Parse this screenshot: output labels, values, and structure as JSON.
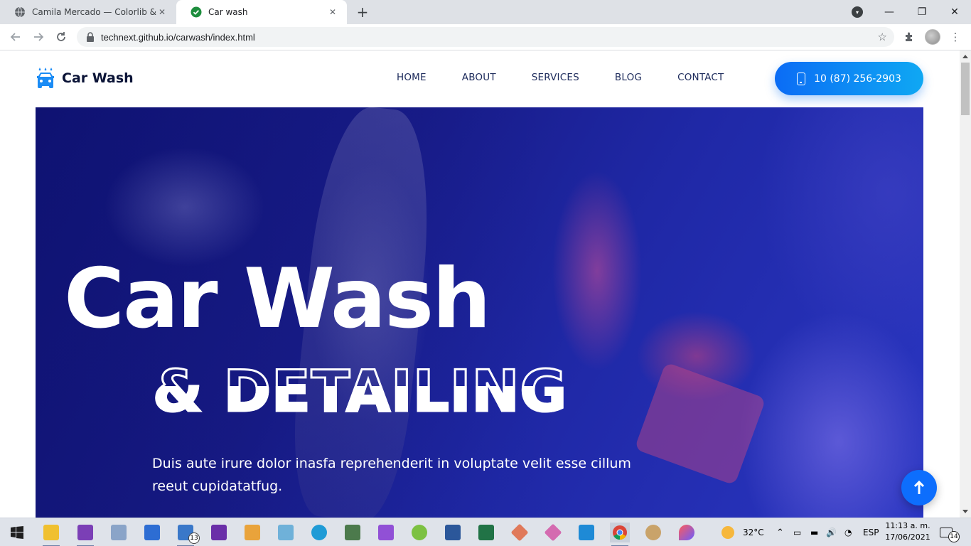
{
  "browser": {
    "tabs": [
      {
        "title": "Camila Mercado — Colorlib & No",
        "active": false
      },
      {
        "title": "Car wash",
        "active": true
      }
    ],
    "url": "technext.github.io/carwash/index.html",
    "icons": [
      "back-icon",
      "forward-icon",
      "reload-icon",
      "lock-icon",
      "star-icon",
      "extensions-icon",
      "profile-avatar"
    ]
  },
  "site": {
    "brand": "Car Wash",
    "nav": [
      "HOME",
      "ABOUT",
      "SERVICES",
      "BLOG",
      "CONTACT"
    ],
    "phone": "10 (87) 256-2903",
    "hero": {
      "title": "Car Wash",
      "subtitle": "& DETAILING",
      "text": "Duis aute irure dolor inasfa reprehenderit in voluptate velit esse cillum reeut cupidatatfug."
    },
    "colors": {
      "brand_dark": "#0b1437",
      "accent": "#0d6efd",
      "hero_overlay": "#181c8a"
    }
  },
  "taskbar": {
    "weather": "32°C",
    "language": "ESP",
    "time": "11:13 a. m.",
    "date": "17/06/2021",
    "notifications": "14",
    "mail_badge": "13"
  }
}
